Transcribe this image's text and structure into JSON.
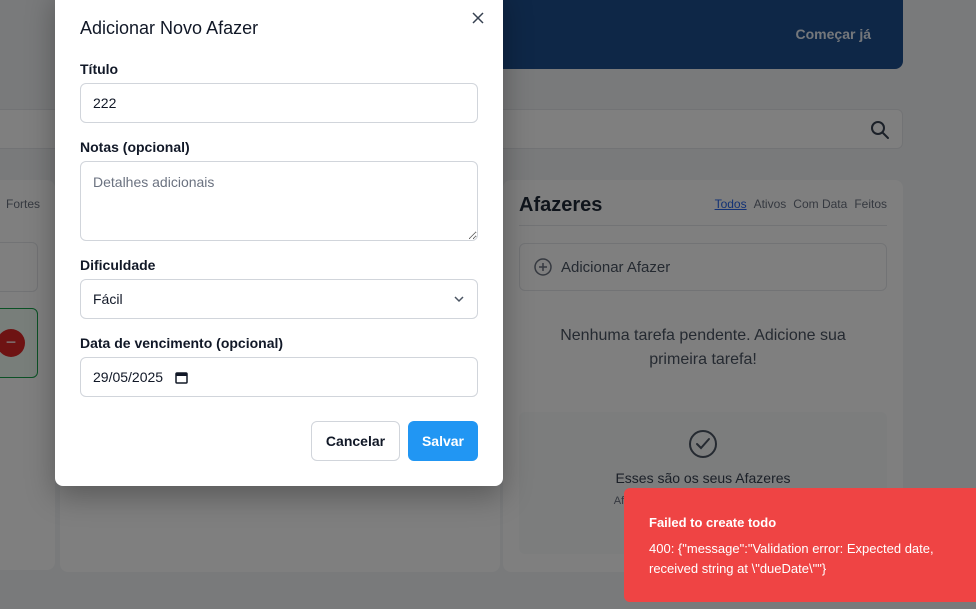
{
  "background": {
    "banner": {
      "cta_label": "Começar já"
    },
    "left_panel": {
      "tab_label": "Fortes"
    },
    "todos_panel": {
      "title": "Afazeres",
      "tabs": [
        {
          "label": "Todos",
          "active": true
        },
        {
          "label": "Ativos",
          "active": false
        },
        {
          "label": "Com Data",
          "active": false
        },
        {
          "label": "Feitos",
          "active": false
        }
      ],
      "add_label": "Adicionar Afazer",
      "empty_text": "Nenhuma tarefa pendente. Adicione sua primeira tarefa!",
      "tips_title": "Esses são os seus Afazeres",
      "tips_desc": "Afazeres concluídos... coisas em s..."
    }
  },
  "modal": {
    "title": "Adicionar Novo Afazer",
    "fields": {
      "title": {
        "label": "Título",
        "value": "222"
      },
      "notes": {
        "label": "Notas (opcional)",
        "placeholder": "Detalhes adicionais",
        "value": ""
      },
      "difficulty": {
        "label": "Dificuldade",
        "value": "Fácil"
      },
      "due_date": {
        "label": "Data de vencimento (opcional)",
        "value": "29/05/2025"
      }
    },
    "buttons": {
      "cancel": "Cancelar",
      "save": "Salvar"
    }
  },
  "toast": {
    "title": "Failed to create todo",
    "message": "400: {\"message\":\"Validation error: Expected date, received string at \\\"dueDate\\\"\"}"
  },
  "colors": {
    "primary": "#2196f3",
    "error": "#ef4444",
    "banner": "#1d4f8e",
    "active_tab": "#2563eb"
  },
  "icons": {
    "close": "close-icon",
    "search": "search-icon",
    "chevron": "chevron-down-icon",
    "calendar": "calendar-icon",
    "add": "plus-circle-icon",
    "check": "check-circle-icon",
    "remove": "minus-circle-icon"
  }
}
